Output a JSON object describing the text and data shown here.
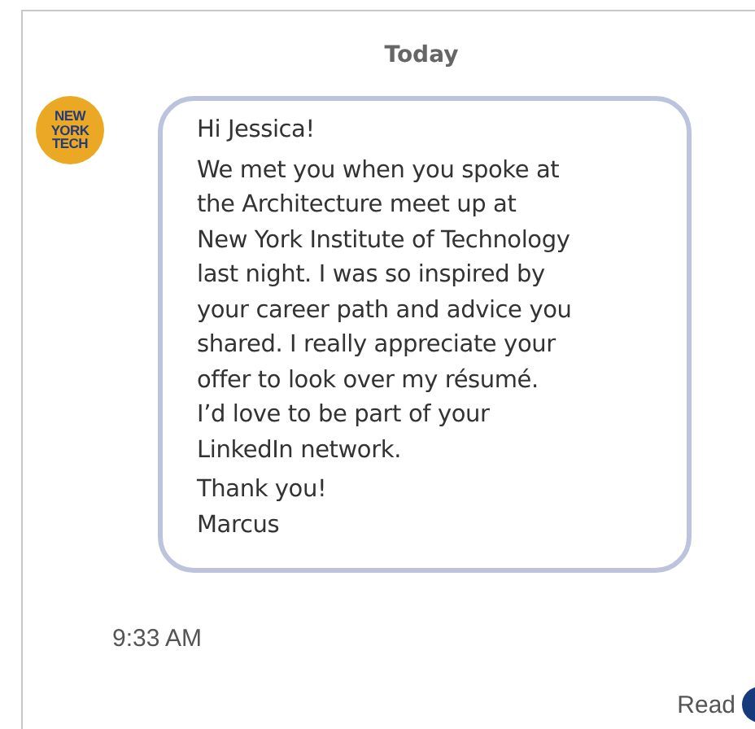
{
  "day_header": "Today",
  "sender": {
    "avatar_lines": [
      "NEW",
      "YORK",
      "TECH"
    ]
  },
  "message": {
    "paragraphs": [
      "Hi Jessica!",
      "We met you when you spoke at\nthe Architecture meet up at\nNew York Institute of Technology\nlast night. I was so inspired by\nyour career path and advice you\nshared. I really appreciate your\noffer to look over my résumé.\nI’d love to be part of your\nLinkedIn network.",
      "Thank you!\nMarcus"
    ]
  },
  "time": "9:33 AM",
  "receipt": {
    "label": "Read"
  }
}
